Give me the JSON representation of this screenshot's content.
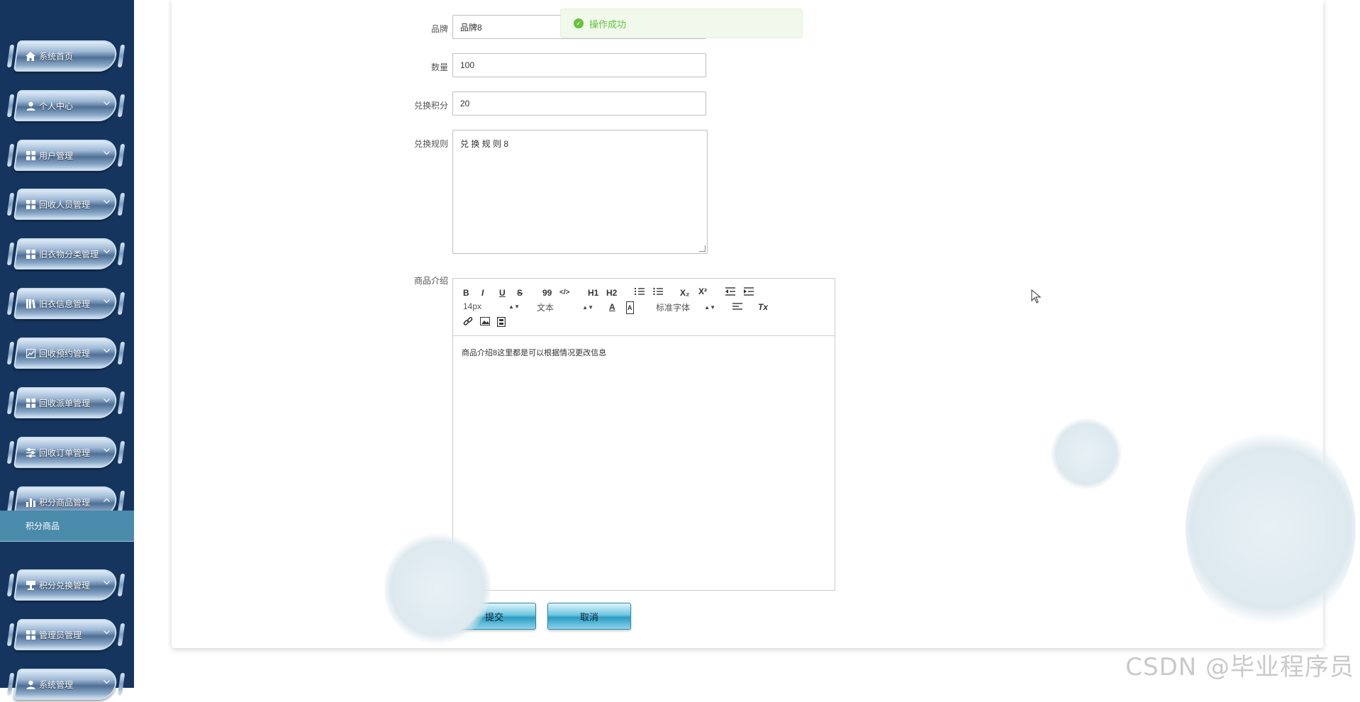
{
  "sidebar": {
    "items": [
      {
        "label": "系统首页",
        "icon": "home-icon",
        "chevron": ""
      },
      {
        "label": "个人中心",
        "icon": "user-icon",
        "chevron": "v"
      },
      {
        "label": "用户管理",
        "icon": "grid-icon",
        "chevron": "v"
      },
      {
        "label": "回收人员管理",
        "icon": "grid-icon",
        "chevron": "v"
      },
      {
        "label": "旧衣物分类管理",
        "icon": "grid-icon",
        "chevron": "v"
      },
      {
        "label": "旧衣信息管理",
        "icon": "book-icon",
        "chevron": "v"
      },
      {
        "label": "回收预约管理",
        "icon": "chart-line-icon",
        "chevron": "v"
      },
      {
        "label": "回收派单管理",
        "icon": "grid-icon",
        "chevron": "v"
      },
      {
        "label": "回收订单管理",
        "icon": "sliders-icon",
        "chevron": "v"
      },
      {
        "label": "积分商品管理",
        "icon": "bar-chart-icon",
        "chevron": "^"
      },
      {
        "label": "积分兑换管理",
        "icon": "desk-icon",
        "chevron": "v"
      },
      {
        "label": "管理员管理",
        "icon": "grid-icon",
        "chevron": "v"
      },
      {
        "label": "系统管理",
        "icon": "user-icon",
        "chevron": "v"
      }
    ],
    "submenu_active": "积分商品"
  },
  "form": {
    "brand_label": "品牌",
    "brand_value": "品牌8",
    "qty_label": "数量",
    "qty_value": "100",
    "points_label": "兑换积分",
    "points_value": "20",
    "rules_label": "兑换规则",
    "rules_value": "兑 换 规 则 8",
    "intro_label": "商品介绍",
    "intro_value": "商品介绍8这里都是可以根据情况更改信息"
  },
  "editor": {
    "font_size": "14px",
    "block_format": "文本",
    "font_family": "标准字体",
    "buttons": {
      "bold": "B",
      "italic": "I",
      "underline": "U",
      "strike": "S",
      "quote": "99",
      "code": "</>",
      "h1": "H1",
      "h2": "H2",
      "sub": "X₂",
      "sup": "X²",
      "clear": "Tx",
      "color": "A",
      "bg": "A"
    }
  },
  "buttons": {
    "submit": "提交",
    "cancel": "取消"
  },
  "toast": {
    "message": "操作成功"
  },
  "watermark": "CSDN @毕业程序员",
  "colors": {
    "sidebar": "#16355e",
    "toast_green": "#67c23a",
    "active_sub": "#4a8aab"
  }
}
